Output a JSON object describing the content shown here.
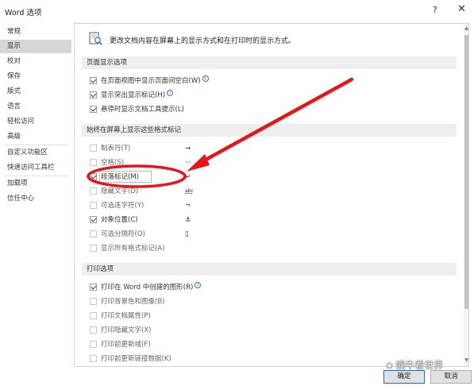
{
  "window": {
    "title": "Word 选项",
    "help_glyph": "?",
    "close_glyph": "✕"
  },
  "sidebar": {
    "items": [
      {
        "label": "常规",
        "active": false
      },
      {
        "label": "显示",
        "active": true
      },
      {
        "label": "校对",
        "active": false
      },
      {
        "label": "保存",
        "active": false
      },
      {
        "label": "版式",
        "active": false
      },
      {
        "label": "语言",
        "active": false
      },
      {
        "label": "轻松访问",
        "active": false
      },
      {
        "label": "高级",
        "active": false
      },
      {
        "label": "自定义功能区",
        "active": false
      },
      {
        "label": "快速访问工具栏",
        "active": false
      },
      {
        "label": "加载项",
        "active": false
      },
      {
        "label": "信任中心",
        "active": false
      }
    ]
  },
  "intro": {
    "text": "更改文档内容在屏幕上的显示方式和在打印时的显示方式。"
  },
  "sections": {
    "page_display": {
      "title": "页面显示选项",
      "options": [
        {
          "label": "在页面视图中显示页面间空白(W)",
          "checked": true,
          "info": true
        },
        {
          "label": "显示突出显示标记(H)",
          "checked": true,
          "info": true
        },
        {
          "label": "悬停时显示文档工具提示(L)",
          "checked": true,
          "info": false
        }
      ]
    },
    "format_marks": {
      "title": "始终在屏幕上显示这些格式标记",
      "options": [
        {
          "label": "制表符(T)",
          "checked": false,
          "symbol": "→"
        },
        {
          "label": "空格(S)",
          "checked": false,
          "symbol": "···"
        },
        {
          "label": "段落标记(M)",
          "checked": true,
          "symbol": "↵"
        },
        {
          "label": "隐藏文字(D)",
          "checked": false,
          "symbol": "abc"
        },
        {
          "label": "可选连字符(Y)",
          "checked": false,
          "symbol": "¬"
        },
        {
          "label": "对象位置(C)",
          "checked": true,
          "symbol": "⚓"
        },
        {
          "label": "可选分隔符(O)",
          "checked": false,
          "symbol": "▯"
        },
        {
          "label": "显示所有格式标记(A)",
          "checked": false,
          "symbol": ""
        }
      ]
    },
    "print": {
      "title": "打印选项",
      "options": [
        {
          "label": "打印在 Word 中创建的图形(R)",
          "checked": true,
          "info": true
        },
        {
          "label": "打印背景色和图像(B)",
          "checked": false,
          "info": false
        },
        {
          "label": "打印文档属性(P)",
          "checked": false,
          "info": false
        },
        {
          "label": "打印隐藏文字(X)",
          "checked": false,
          "info": false
        },
        {
          "label": "打印前更新域(F)",
          "checked": false,
          "info": false
        },
        {
          "label": "打印前更新链接数据(K)",
          "checked": false,
          "info": false
        }
      ]
    }
  },
  "buttons": {
    "ok": "确定",
    "cancel": "取消"
  },
  "watermark": {
    "text": "蜗牛看世界"
  },
  "annotation": {
    "color": "#e8131b"
  }
}
